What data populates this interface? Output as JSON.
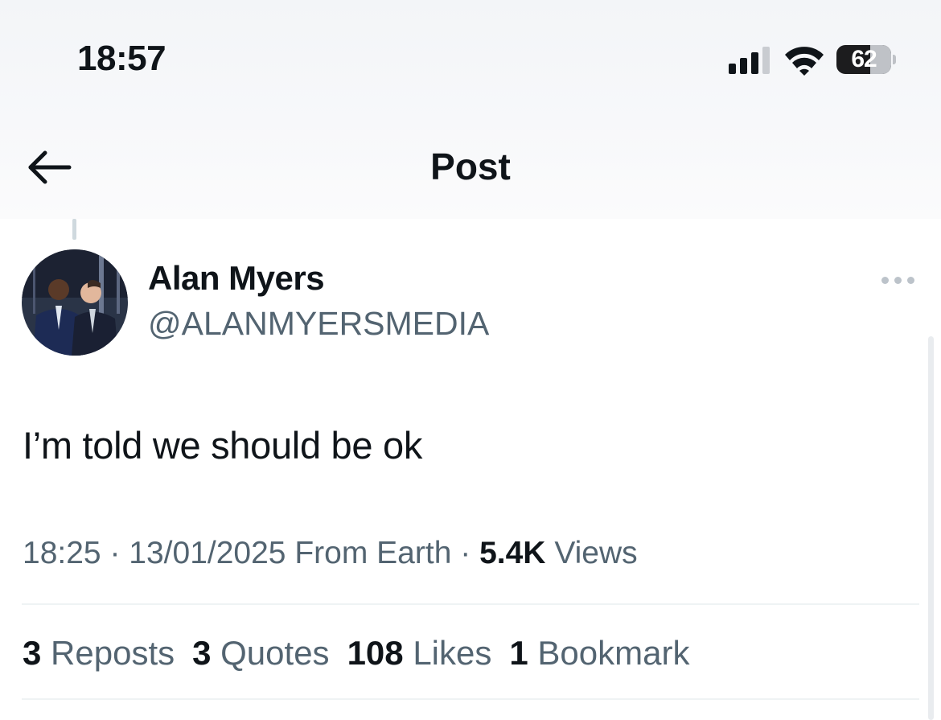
{
  "status_bar": {
    "time": "18:57",
    "battery_level": "62",
    "battery_fraction": 0.62,
    "signal_bars_active": 3,
    "signal_bars_total": 4
  },
  "nav": {
    "back_icon": "arrow-left-icon",
    "title": "Post"
  },
  "post": {
    "author": {
      "name": "Alan Myers",
      "handle": "@ALANMYERSMEDIA"
    },
    "more_icon": "more-horizontal-icon",
    "text": "I’m told we should be ok",
    "meta": {
      "time": "18:25",
      "date": "13/01/2025",
      "location": "From Earth",
      "views_count": "5.4K",
      "views_label": "Views",
      "separator": "·"
    },
    "stats": [
      {
        "count": "3",
        "label": "Reposts"
      },
      {
        "count": "3",
        "label": "Quotes"
      },
      {
        "count": "108",
        "label": "Likes"
      },
      {
        "count": "1",
        "label": "Bookmark"
      }
    ]
  },
  "colors": {
    "text_primary": "#0f1419",
    "text_secondary": "#536471",
    "divider": "#eff3f4"
  }
}
